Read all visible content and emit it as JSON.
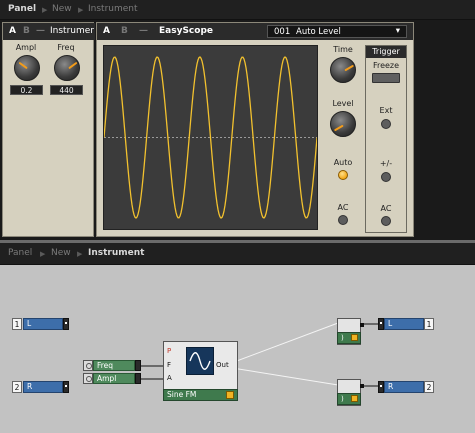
{
  "top": {
    "breadcrumb": [
      "Panel",
      "New",
      "Instrument"
    ],
    "instrument_panel": {
      "tab_a": "A",
      "tab_b": "B",
      "tab_dash": "—",
      "title": "Instrument",
      "knobs": [
        {
          "label": "Ampl",
          "value": "0.2",
          "level": 0.3
        },
        {
          "label": "Freq",
          "value": "440",
          "level": 0.7
        }
      ]
    },
    "scope_panel": {
      "tab_a": "A",
      "tab_b": "B",
      "tab_dash": "—",
      "title": "EasyScope",
      "preset_number": "001",
      "preset_name": "Auto Level",
      "preset_arrow": "▾",
      "time_label": "Time",
      "level_label": "Level",
      "auto_label": "Auto",
      "ac_label": "AC",
      "trigger": {
        "title": "Trigger",
        "freeze_label": "Freeze",
        "ext_label": "Ext",
        "polarity_label": "+/-",
        "ac_label": "AC"
      },
      "waveform": {
        "cycles": 5,
        "amplitude": 0.92,
        "color": "#f2c12e",
        "background": "#3b3b3b"
      }
    }
  },
  "bottom": {
    "breadcrumb": [
      "Panel",
      "New",
      "Instrument"
    ],
    "inputs": [
      {
        "num": "1",
        "label": "L"
      },
      {
        "num": "2",
        "label": "R"
      }
    ],
    "controls": [
      {
        "label": "Freq"
      },
      {
        "label": "Ampl"
      }
    ],
    "module": {
      "name": "Sine FM",
      "ports": [
        "P",
        "F",
        "A"
      ],
      "output_label": "Out"
    },
    "outputs": [
      {
        "num": "1",
        "label": "L"
      },
      {
        "num": "2",
        "label": "R"
      }
    ],
    "mini_label": ")",
    "colors": {
      "accent": "#f0b323",
      "terminal": "#3d6eaa",
      "control": "#4f8a5d"
    }
  }
}
